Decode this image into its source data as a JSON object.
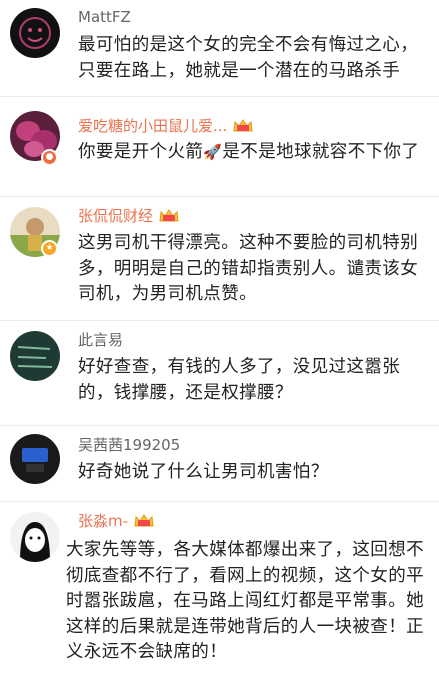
{
  "comments": [
    {
      "user": "MattFZ",
      "vip": false,
      "text": "最可怕的是这个女的完全不会有悔过之心，只要在路上，她就是一个潜在的马路杀手"
    },
    {
      "user": "爱吃糖的小田鼠儿爱...",
      "vip": true,
      "text_before": "你要是开个火箭",
      "emoji": "🚀",
      "text_after": "是不是地球就容不下你了"
    },
    {
      "user": "张侃侃财经",
      "vip": true,
      "text": "这男司机干得漂亮。这种不要脸的司机特别多，明明是自己的错却指责别人。谴责该女司机，为男司机点赞。"
    },
    {
      "user": "此言易",
      "vip": false,
      "text": "好好查查，有钱的人多了，没见过这嚣张的，钱撑腰，还是权撑腰？"
    },
    {
      "user": "吴茜茜199205",
      "vip": false,
      "text": "好奇她说了什么让男司机害怕？"
    },
    {
      "user": "张淼m-",
      "vip": true,
      "text": "大家先等等，各大媒体都爆出来了，这回想不彻底查都不行了，看网上的视频，这个女的平时嚣张跋扈，在马路上闯红灯都是平常事。她这样的后果就是连带她背后的人一块被查！正义永远不会缺席的！"
    }
  ],
  "icons": {
    "vip": "crown-vip-icon",
    "badge": "weibo-verified-badge-icon"
  },
  "colors": {
    "vip_name": "#eb7350",
    "plain_name": "#666666",
    "text": "#222222",
    "divider": "#ececec"
  }
}
